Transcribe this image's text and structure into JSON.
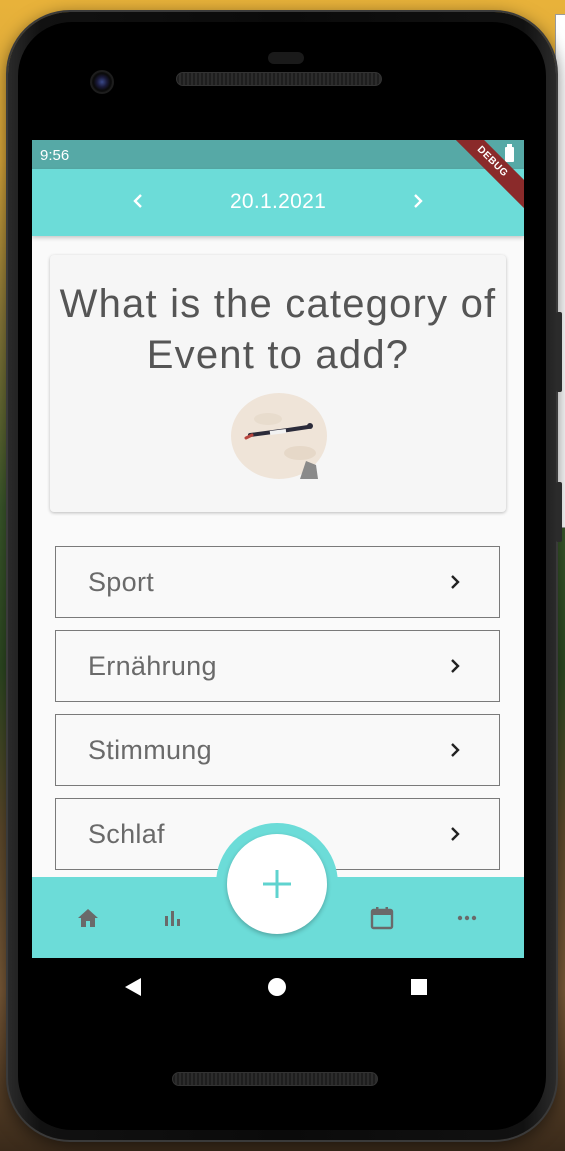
{
  "status_bar": {
    "time": "9:56",
    "battery_icon": "battery-full-icon"
  },
  "debug_banner": "DEBUG",
  "app_bar": {
    "date": "20.1.2021",
    "prev_icon": "chevron-left-icon",
    "next_icon": "chevron-right-icon"
  },
  "question": {
    "title": "What is the category of Event to add?",
    "illustration": "flying-person-illustration"
  },
  "categories": [
    {
      "label": "Sport"
    },
    {
      "label": "Ernährung"
    },
    {
      "label": "Stimmung"
    },
    {
      "label": "Schlaf"
    }
  ],
  "bottom_nav": {
    "items": [
      "home-icon",
      "bar-chart-icon",
      "calendar-icon",
      "more-horiz-icon"
    ],
    "fab_icon": "add-icon"
  },
  "system_nav": [
    "back-icon",
    "home-circle-icon",
    "recents-square-icon"
  ],
  "colors": {
    "primary": "#6cdcd8",
    "status_bar": "#56a9a6",
    "icon_gray": "#6a6a6a"
  }
}
